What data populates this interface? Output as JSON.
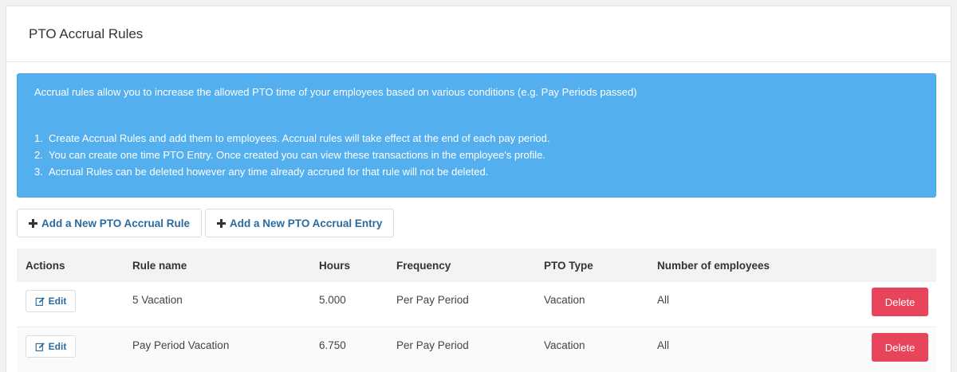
{
  "panel": {
    "title": "PTO Accrual Rules"
  },
  "alert": {
    "intro": "Accrual rules allow you to increase the allowed PTO time of your employees based on various conditions (e.g. Pay Periods passed)",
    "items": [
      {
        "num": "1.",
        "text": "Create Accrual Rules and add them to employees. Accrual rules will take effect at the end of each pay period."
      },
      {
        "num": "2.",
        "text": "You can create one time PTO Entry. Once created you can view these transactions in the employee's profile."
      },
      {
        "num": "3.",
        "text": "Accrual Rules can be deleted however any time already accrued for that rule will not be deleted."
      }
    ]
  },
  "buttons": {
    "add_rule": "Add a New PTO Accrual Rule",
    "add_entry": "Add a New PTO Accrual Entry",
    "icon": "plus-icon"
  },
  "table": {
    "headers": {
      "actions": "Actions",
      "rule_name": "Rule name",
      "hours": "Hours",
      "frequency": "Frequency",
      "pto_type": "PTO Type",
      "num_employees": "Number of employees"
    },
    "rows": [
      {
        "edit": "Edit",
        "rule_name": "5 Vacation",
        "hours": "5.000",
        "frequency": "Per Pay Period",
        "pto_type": "Vacation",
        "num_employees": "All",
        "delete": "Delete"
      },
      {
        "edit": "Edit",
        "rule_name": "Pay Period Vacation",
        "hours": "6.750",
        "frequency": "Per Pay Period",
        "pto_type": "Vacation",
        "num_employees": "All",
        "delete": "Delete"
      }
    ]
  },
  "colors": {
    "alert_bg": "#54afef",
    "link": "#2a6a9e",
    "delete_bg": "#e8445c"
  }
}
